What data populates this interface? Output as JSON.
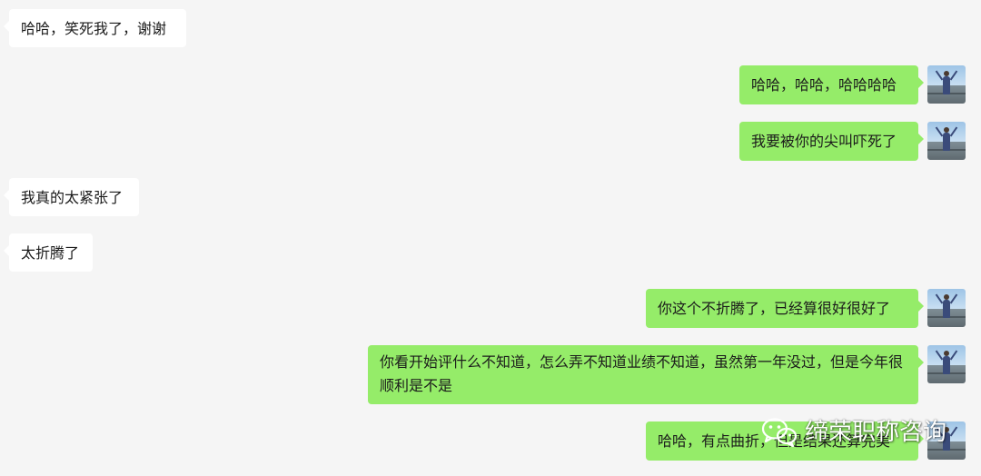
{
  "messages": [
    {
      "side": "left",
      "text": "哈哈，笑死我了，谢谢"
    },
    {
      "side": "right",
      "text": "哈哈，哈哈，哈哈哈哈"
    },
    {
      "side": "right",
      "text": "我要被你的尖叫吓死了"
    },
    {
      "side": "left",
      "text": "我真的太紧张了"
    },
    {
      "side": "left",
      "text": "太折腾了"
    },
    {
      "side": "right",
      "text": "你这个不折腾了，已经算很好很好了"
    },
    {
      "side": "right",
      "text": "你看开始评什么不知道，怎么弄不知道业绩不知道，虽然第一年没过，但是今年很顺利是不是"
    },
    {
      "side": "right",
      "text": "哈哈，有点曲折，但是结果还算完美"
    }
  ],
  "watermark": {
    "text": "缔荣职称咨询",
    "icon": "wechat-icon"
  }
}
